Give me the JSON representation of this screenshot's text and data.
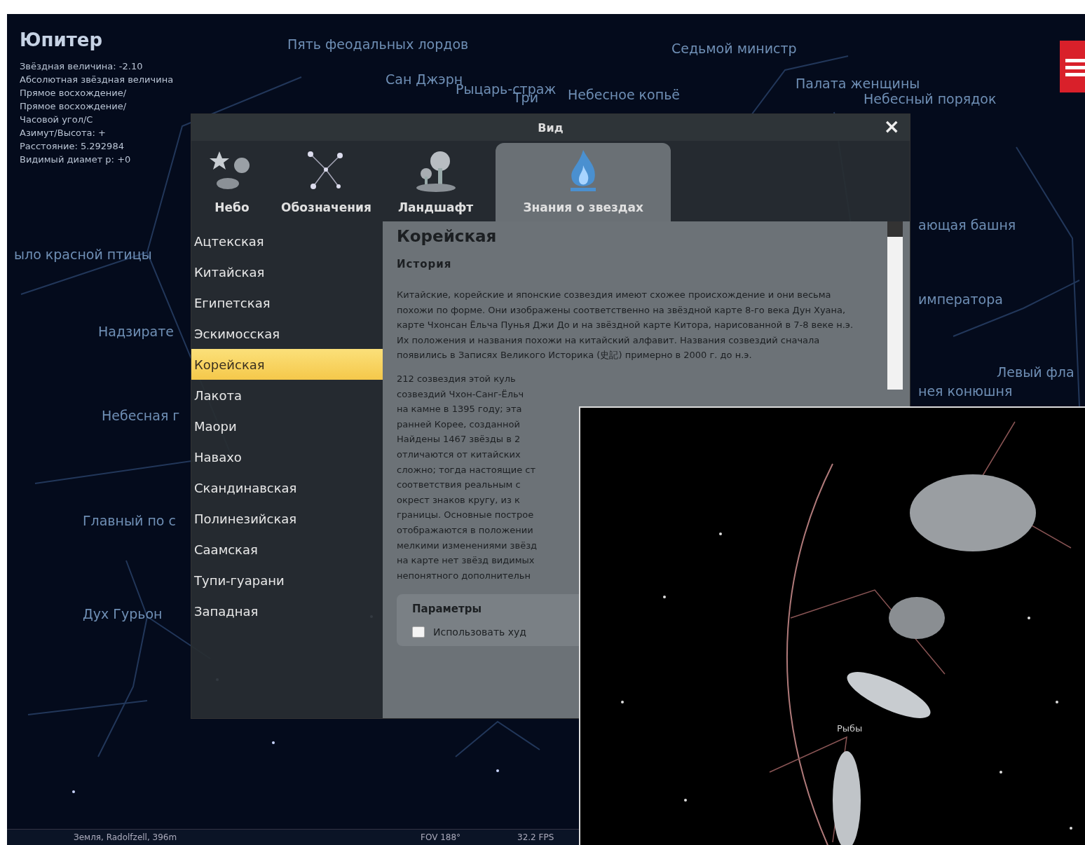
{
  "sky_labels": [
    "Пять феодальных лордов",
    "Седьмой министр",
    "Сан Джэрн",
    "Рыцарь-страж",
    "Три",
    "Небесное копьё",
    "Палата женщины",
    "Небесный порядок",
    "ыло красной птицы",
    "Надзирате",
    "Небесная г",
    "Главный по с",
    "Дух Гурьон",
    "ающая башня",
    "императора",
    "нея конюшня",
    "Левый фла"
  ],
  "object_info": {
    "name": "Юпитер",
    "lines": [
      "Звёздная величина: -2.10",
      "Абсолютная звёздная величина",
      "Прямое восхождение/",
      "Прямое восхождение/",
      "Часовой угол/С",
      "Азимут/Высота: +",
      "Расстояние: 5.292984",
      "Видимый диамет р: +0"
    ]
  },
  "dialog": {
    "title": "Вид",
    "close": "×",
    "tabs": [
      {
        "label": "Небо",
        "selected": false
      },
      {
        "label": "Обозначения",
        "selected": false
      },
      {
        "label": "Ландшафт",
        "selected": false
      },
      {
        "label": "Знания о звездах",
        "selected": true
      }
    ],
    "cultures": [
      {
        "label": "Ацтекская",
        "selected": false
      },
      {
        "label": "Китайская",
        "selected": false
      },
      {
        "label": "Египетская",
        "selected": false
      },
      {
        "label": "Эскимосская",
        "selected": false
      },
      {
        "label": "Корейская",
        "selected": true
      },
      {
        "label": "Лакота",
        "selected": false
      },
      {
        "label": "Маори",
        "selected": false
      },
      {
        "label": "Навахо",
        "selected": false
      },
      {
        "label": "Скандинавская",
        "selected": false
      },
      {
        "label": "Полинезийская",
        "selected": false
      },
      {
        "label": "Саамская",
        "selected": false
      },
      {
        "label": "Тупи-гуарани",
        "selected": false
      },
      {
        "label": "Западная",
        "selected": false
      }
    ],
    "heading": "Корейская",
    "subheading": "История",
    "paragraph": "Китайские, корейские и японские созвездия имеют схожее происхождение и они весьма похожи по форме. Они изображены соответственно на звёздной карте 8-го века Дун Хуана, карте Чхонсан Ёльча Пунья Джи До и на звёздной карте Китора, нарисованной в 7-8 веке н.э. Их положения и названия похожи на китайский алфавит. Названия созвездий сначала появились в Записях Великого Историка (史記) примерно в 2000 г. до н.э.",
    "paragraph_2_lines": [
      "212 созвездия этой куль",
      "созвездий Чхон-Санг-Ёльч",
      "на камне в 1395 году; эта",
      "ранней Корее, созданной",
      "Найдены 1467 звёзды в 2",
      "отличаются от китайских",
      "сложно; тогда настоящие ст",
      "соответствия реальным с",
      "окрест знаков кругу, из к",
      "границы. Основные построе",
      "отображаются в положении",
      "мелкими изменениями звёзд",
      "на карте нет звёзд видимых",
      "непонятного дополнительн"
    ],
    "options": {
      "title": "Параметры",
      "checkbox_label": "Использовать худ",
      "checked": false
    }
  },
  "inset": {
    "label": "Рыбы"
  },
  "status_bar": {
    "location": "Земля, Radolfzell, 396m",
    "fov": "FOV 188°",
    "fps": "32.2 FPS"
  }
}
